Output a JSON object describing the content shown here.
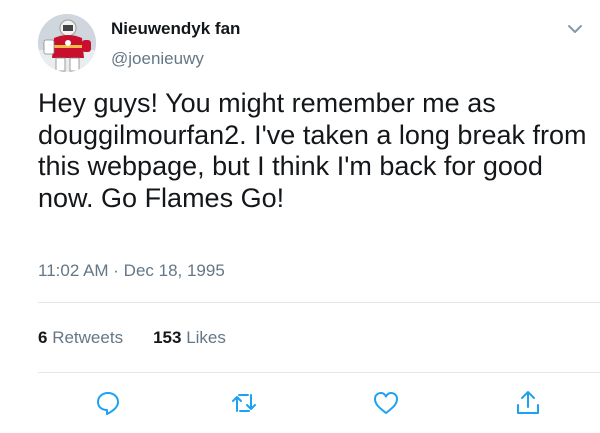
{
  "user": {
    "display_name": "Nieuwendyk fan",
    "handle": "@joenieuwy",
    "avatar": "hockey-goalie-avatar"
  },
  "tweet": {
    "text": "Hey guys! You might remember me as douggilmourfan2. I've taken a long break from this webpage, but I think I'm back for good now. Go Flames Go!",
    "timestamp": "11:02 AM · Dec 18, 1995"
  },
  "stats": {
    "retweets_count": "6",
    "retweets_label": "Retweets",
    "likes_count": "153",
    "likes_label": "Likes"
  },
  "actions": [
    "reply-icon",
    "retweet-icon",
    "like-icon",
    "share-icon"
  ],
  "colors": {
    "text": "#14171a",
    "secondary": "#657786",
    "divider": "#e1e8ed",
    "action_icon": "#1da1f2",
    "avatar_jersey": "#c8102e"
  }
}
